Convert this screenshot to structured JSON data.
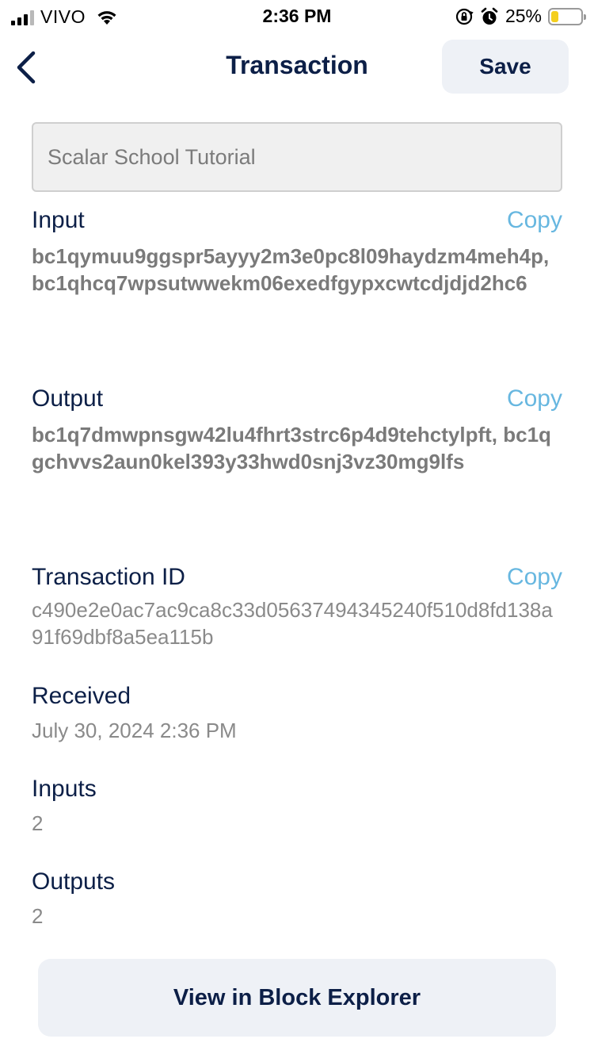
{
  "status_bar": {
    "carrier": "VIVO",
    "time": "2:36 PM",
    "battery_percent": "25%",
    "battery_level": 0.25,
    "icons": [
      "signal-icon",
      "wifi-icon",
      "orientation-lock-icon",
      "alarm-icon",
      "battery-icon"
    ]
  },
  "nav": {
    "title": "Transaction",
    "save_label": "Save",
    "back_icon": "chevron-left-icon"
  },
  "memo": {
    "placeholder": "Scalar School Tutorial"
  },
  "sections": {
    "input": {
      "label": "Input",
      "copy": "Copy",
      "addresses": "bc1qymuu9ggspr5ayyy2m3e0pc8l09haydzm4meh4p, bc1qhcq7wpsutwwekm06exedfgypxcwtcdjdjd2hc6"
    },
    "output": {
      "label": "Output",
      "copy": "Copy",
      "addresses": "bc1q7dmwpnsgw42lu4fhrt3strc6p4d9tehctylpft, bc1qgchvvs2aun0kel393y33hwd0snj3vz30mg9lfs"
    },
    "txid": {
      "label": "Transaction ID",
      "copy": "Copy",
      "value": "c490e2e0ac7ac9ca8c33d05637494345240f510d8fd138a91f69dbf8a5ea115b"
    },
    "received": {
      "label": "Received",
      "value": "July 30, 2024 2:36 PM"
    },
    "inputs": {
      "label": "Inputs",
      "value": "2"
    },
    "outputs": {
      "label": "Outputs",
      "value": "2"
    }
  },
  "footer": {
    "explorer_label": "View in Block Explorer"
  },
  "colors": {
    "primary_text": "#0c1f47",
    "link": "#67b7e0",
    "muted": "#7a7a7a",
    "button_bg": "#eef1f6",
    "battery": "#f4cf1e"
  }
}
